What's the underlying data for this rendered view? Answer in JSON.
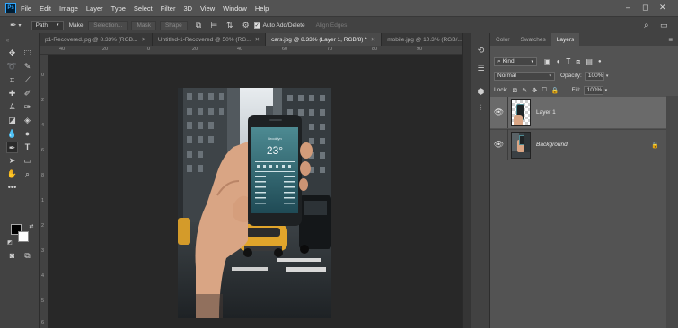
{
  "menubar": {
    "logo": "Ps",
    "items": [
      "File",
      "Edit",
      "Image",
      "Layer",
      "Type",
      "Select",
      "Filter",
      "3D",
      "View",
      "Window",
      "Help"
    ],
    "window_controls": [
      "–",
      "◻",
      "✕"
    ]
  },
  "options": {
    "mode": "Path",
    "make_label": "Make:",
    "selection_btn": "Selection...",
    "mask_btn": "Mask",
    "shape_btn": "Shape",
    "auto_add_delete": "Auto Add/Delete",
    "auto_add_delete_checked": true,
    "align_edges": "Align Edges"
  },
  "tabs": [
    {
      "label": "p1-Recovered.jpg @ 8.33% (RGB...",
      "active": false
    },
    {
      "label": "Untitled-1-Recovered @ 50% (RG...",
      "active": false
    },
    {
      "label": "cars.jpg @ 8.33% (Layer 1, RGB/8) *",
      "active": true
    },
    {
      "label": "mobile.jpg @ 10.3% (RGB/...",
      "active": false
    }
  ],
  "ruler_h": [
    "40",
    "20",
    "0",
    "20",
    "40",
    "60",
    "70",
    "80",
    "90"
  ],
  "ruler_v": [
    "0",
    "2",
    "4",
    "6",
    "8",
    "1",
    "2",
    "3",
    "4",
    "5",
    "6"
  ],
  "phone": {
    "city": "Brooklyn",
    "temp": "23°"
  },
  "panels": {
    "tabs": [
      {
        "label": "Color",
        "active": false
      },
      {
        "label": "Swatches",
        "active": false
      },
      {
        "label": "Layers",
        "active": true
      }
    ],
    "filter_kind": "Kind",
    "blend_mode": "Normal",
    "opacity_label": "Opacity:",
    "opacity_value": "100%",
    "lock_label": "Lock:",
    "fill_label": "Fill:",
    "fill_value": "100%",
    "layers": [
      {
        "name": "Layer 1",
        "selected": true,
        "italic": false,
        "locked": false
      },
      {
        "name": "Background",
        "selected": false,
        "italic": true,
        "locked": true
      }
    ]
  },
  "colors": {
    "app_bg": "#2b2b2b",
    "menubar": "#535353",
    "panel": "#424242",
    "layers_bg": "#535353",
    "selected_layer": "#6a6a6a",
    "accent": "#31a8ff"
  }
}
